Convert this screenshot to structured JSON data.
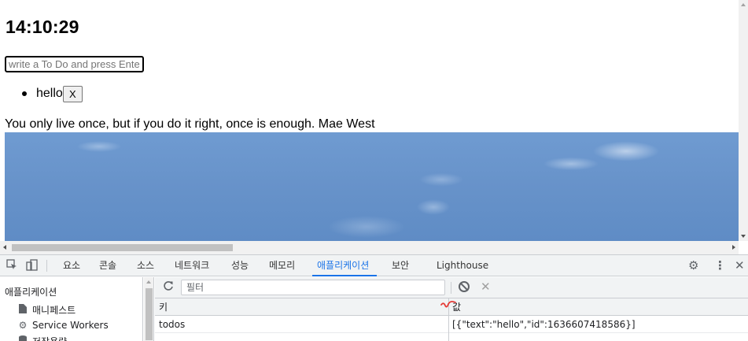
{
  "page": {
    "clock": "14:10:29",
    "todo_input_placeholder": "write a To Do and press Enter",
    "todos": [
      {
        "text": "hello",
        "delete_label": "X"
      }
    ],
    "quote": "You only live once, but if you do it right, once is enough. Mae West",
    "background_image": "sky-photo"
  },
  "devtools": {
    "tabs": [
      "요소",
      "콘솔",
      "소스",
      "네트워크",
      "성능",
      "메모리",
      "애플리케이션",
      "보안",
      "Lighthouse"
    ],
    "active_tab": "애플리케이션",
    "sidebar": {
      "title": "애플리케이션",
      "items": [
        {
          "label": "매니페스트",
          "icon": "file-icon"
        },
        {
          "label": "Service Workers",
          "icon": "gear-icon"
        },
        {
          "label": "저장용량",
          "icon": "database-icon"
        }
      ]
    },
    "toolbar": {
      "filter_placeholder": "필터"
    },
    "table": {
      "columns": [
        "키",
        "값"
      ],
      "rows": [
        {
          "key": "todos",
          "value": "[{\"text\":\"hello\",\"id\":1636607418586}]"
        }
      ]
    },
    "colors": {
      "accent": "#1a73e8",
      "toolbar_bg": "#f1f3f4",
      "border": "#cacdd1",
      "annotation": "#e53935"
    }
  }
}
